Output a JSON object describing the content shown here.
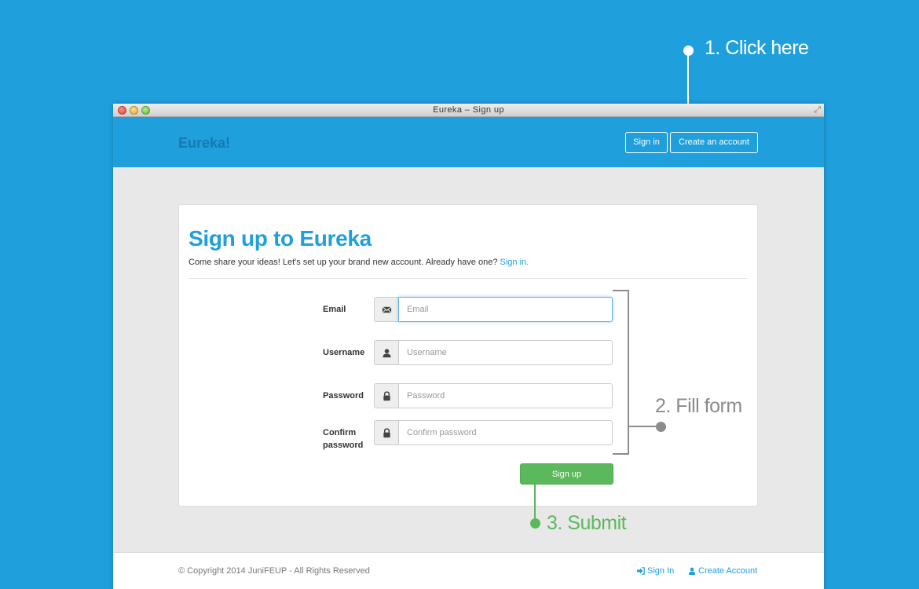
{
  "annotations": {
    "step1": "1. Click here",
    "step2": "2. Fill form",
    "step3": "3. Submit",
    "colors": {
      "step1": "#ffffff",
      "step2": "#8c8c8c",
      "step3": "#5cb85c"
    }
  },
  "window": {
    "title": "Eureka – Sign up"
  },
  "navbar": {
    "brand": "Eureka!",
    "signin_label": "Sign in",
    "create_label": "Create an account"
  },
  "form": {
    "heading": "Sign up to Eureka",
    "intro_text": "Come share your ideas! Let's set up your brand new account. Already have one?",
    "intro_link": "Sign in.",
    "fields": [
      {
        "label": "Email",
        "placeholder": "Email",
        "value": "",
        "icon": "envelope-icon"
      },
      {
        "label": "Username",
        "placeholder": "Username",
        "value": "",
        "icon": "user-icon"
      },
      {
        "label": "Password",
        "placeholder": "Password",
        "value": "",
        "icon": "lock-icon"
      },
      {
        "label": "Confirm password",
        "placeholder": "Confirm password",
        "value": "",
        "icon": "lock-icon"
      }
    ],
    "submit_label": "Sign up"
  },
  "footer": {
    "copyright": "© Copyright 2014 JuniFEUP - All Rights Reserved",
    "signin_link": "Sign In",
    "create_link": "Create Account"
  },
  "colors": {
    "brand_blue": "#1fa0dd",
    "success_green": "#5cb85c",
    "page_background": "#e8e8e8"
  }
}
